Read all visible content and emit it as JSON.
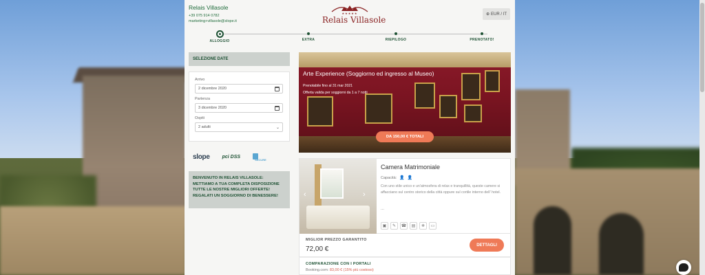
{
  "header": {
    "hotel_name": "Relais Villasole",
    "phone": "+39 075 914 0782",
    "email": "marketing+villasole@slope.it",
    "logo_text": "Relais Villasole",
    "logo_stars": "★★★★★",
    "language": "EUR / IT"
  },
  "steps": [
    {
      "label": "ALLOGGIO",
      "active": true
    },
    {
      "label": "EXTRA",
      "active": false
    },
    {
      "label": "RIEPILOGO",
      "active": false
    },
    {
      "label": "PRENOTATO!",
      "active": false
    }
  ],
  "sidebar": {
    "section_title": "SELEZIONE DATE",
    "arrival_label": "Arrivo",
    "arrival_value": "2 dicembre 2020",
    "departure_label": "Partenza",
    "departure_value": "3 dicembre 2020",
    "guests_label": "Ospiti",
    "guests_value": "2 adulti",
    "payments": {
      "slope": "slope",
      "pci": "pci DSS",
      "secure": "SECURE"
    },
    "welcome": "Benvenuto in Relais Villasole: mettiamo a tua completa disposizione tutte le nostre migliori offerte! Regalati un soggiorno di benessere!"
  },
  "offer": {
    "title": "Arte Experience (Soggiorno ed ingresso al Museo)",
    "bookable_until": "Prenotabile fino al 31 mar 2021",
    "validity": "Offerta valida per soggiorni da 1 a 7 notti",
    "price_button": "DA 150,00 € TOTALI"
  },
  "room": {
    "title": "Camera Matrimoniale",
    "capacity_label": "Capacità:",
    "description": "Con uno stile unico e un'atmosfera di relax e tranquillità, queste camere si affacciano sul centro storico della città oppure sul cortile interno dell' hotel.",
    "more": "...",
    "best_price_label": "MIGLIOR PREZZO GARANTITO",
    "price": "72,00 €",
    "details_button": "DETTAGLI"
  },
  "comparison": {
    "title": "COMPARAZIONE CON I PORTALI",
    "line_prefix": "Booking.com:",
    "line_value": "83,00 € (15% più costoso)"
  },
  "colors": {
    "accent_green": "#1d5133",
    "orange_button": "#ef7a57",
    "logo_red": "#8a2323",
    "panel_gray": "#ccd1cd"
  }
}
